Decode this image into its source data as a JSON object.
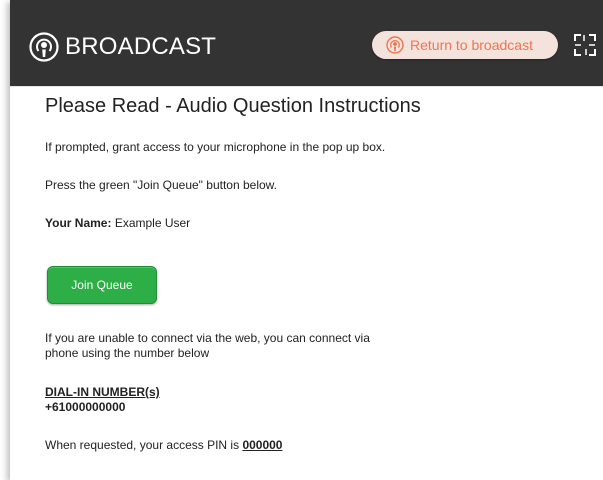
{
  "header": {
    "brand_icon": "podcast-icon",
    "title": "BROADCAST",
    "return_button": {
      "label": "Return to broadcast",
      "icon": "podcast-icon"
    },
    "expand_icon": "fullscreen-expand-icon",
    "colors": {
      "background": "#333333",
      "accent": "#ee7650",
      "return_bg": "#f4e3dd"
    }
  },
  "main": {
    "title": "Please Read - Audio Question Instructions",
    "line_prompt": "If prompted, grant access to your microphone in the pop up box.",
    "line_press": "Press the green \"Join Queue\" button below.",
    "name_label": "Your Name:",
    "name_value": "Example User",
    "join_button": {
      "label": "Join Queue",
      "color": "#2dae46"
    },
    "phone_line1": "If you are unable to connect via the web, you can connect via",
    "phone_line2": "phone using the number below",
    "dial_in_heading": "DIAL-IN NUMBER(s)",
    "dial_in_number": "+61000000000",
    "pin_text": "When requested, your access PIN is",
    "pin_value": "000000"
  }
}
